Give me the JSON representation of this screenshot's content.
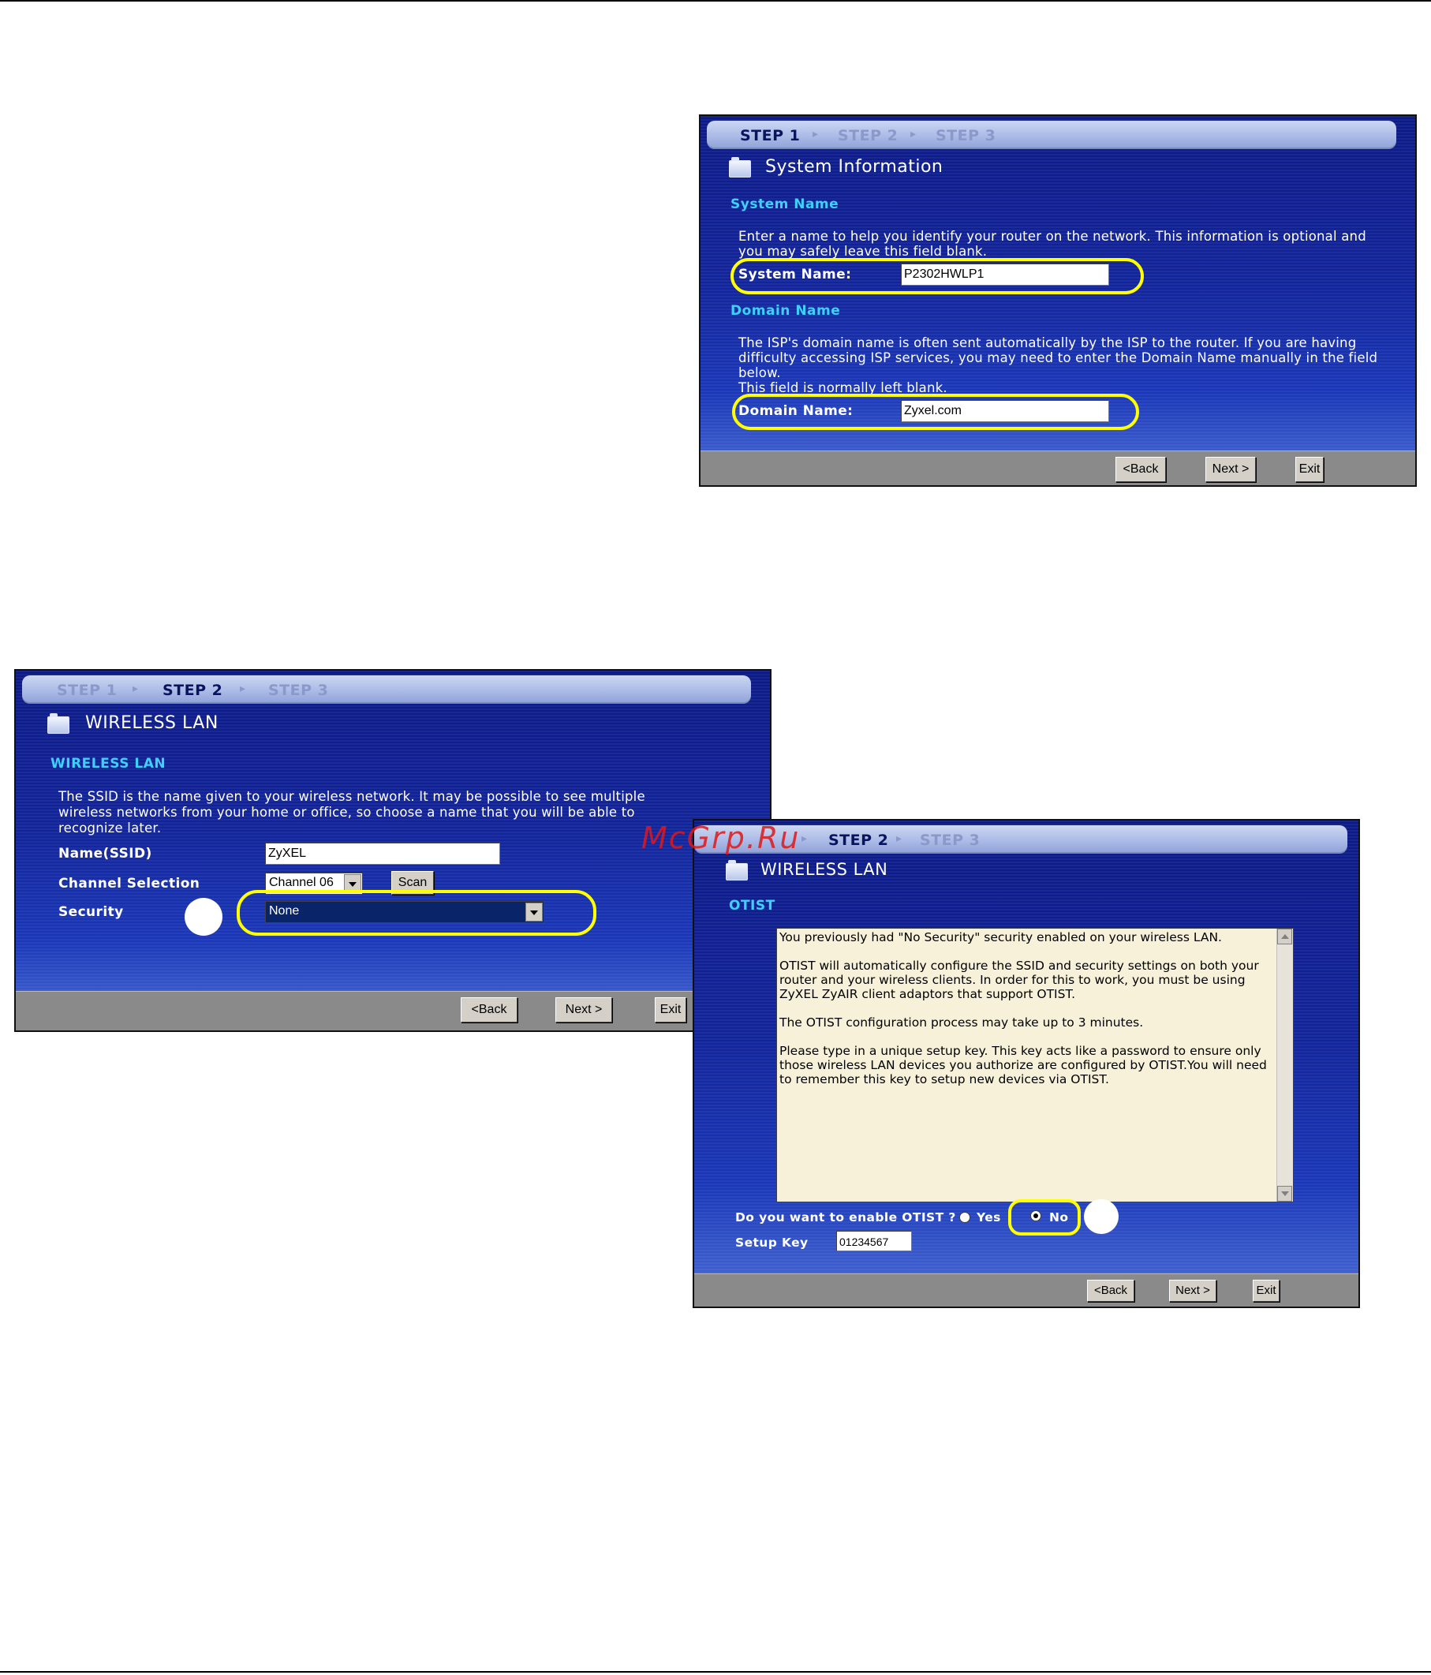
{
  "panel1": {
    "steps": [
      "STEP 1",
      "STEP 2",
      "STEP 3"
    ],
    "title": "System Information",
    "section1": "System Name",
    "desc1_line1": "Enter a name to help you identify your router on the network. This information is optional and",
    "desc1_line2": "you may safely leave this field blank.",
    "system_name_label": "System Name:",
    "system_name_value": "P2302HWLP1",
    "section2": "Domain Name",
    "desc2_line1": "The ISP's domain name is often sent automatically by the ISP to the router. If you are having",
    "desc2_line2": "difficulty accessing ISP services, you may need to enter the Domain Name manually in the field",
    "desc2_line3": "below.",
    "desc2_line4": "This field is normally left blank.",
    "domain_name_label": "Domain Name:",
    "domain_name_value": "Zyxel.com",
    "back": "<Back",
    "next": "Next >",
    "exit": "Exit"
  },
  "panel2": {
    "steps": [
      "STEP 1",
      "STEP 2",
      "STEP 3"
    ],
    "title": "WIRELESS LAN",
    "section": "WIRELESS LAN",
    "desc_line1": "The SSID is the name given to your wireless network. It may be possible to see multiple",
    "desc_line2": "wireless networks from your home or office, so choose a name that you will be able to",
    "desc_line3": "recognize later.",
    "ssid_label": "Name(SSID)",
    "ssid_value": "ZyXEL",
    "channel_label": "Channel Selection",
    "channel_value": "Channel 06",
    "scan": "Scan",
    "security_label": "Security",
    "security_value": "None",
    "back": "<Back",
    "next": "Next >",
    "exit": "Exit"
  },
  "panel3": {
    "steps": [
      "STEP 2",
      "STEP 3"
    ],
    "title": "WIRELESS LAN",
    "section": "OTIST",
    "text_p1": "You previously had \"No Security\" security enabled on your wireless LAN.",
    "text_p2": "OTIST will automatically configure the SSID and security settings on both your router and your wireless clients. In order for this to work, you must be using ZyXEL ZyAIR client adaptors that support OTIST.",
    "text_p3": "The OTIST configuration process may take up to 3 minutes.",
    "text_p4": "Please type in a unique setup key. This key acts like a password to ensure only those wireless LAN devices you authorize are configured by OTIST.You will need to remember this key to setup new devices via OTIST.",
    "question": "Do you want to enable OTIST ?",
    "yes": "Yes",
    "no": "No",
    "setup_key_label": "Setup Key",
    "setup_key_value": "01234567",
    "back": "<Back",
    "next": "Next >",
    "exit": "Exit"
  },
  "watermark": "McGrp.Ru",
  "colors": {
    "panel_blue": "#12249a",
    "section_cyan": "#3fd0ff",
    "highlight": "#ffff00",
    "watermark": "#e01818"
  }
}
